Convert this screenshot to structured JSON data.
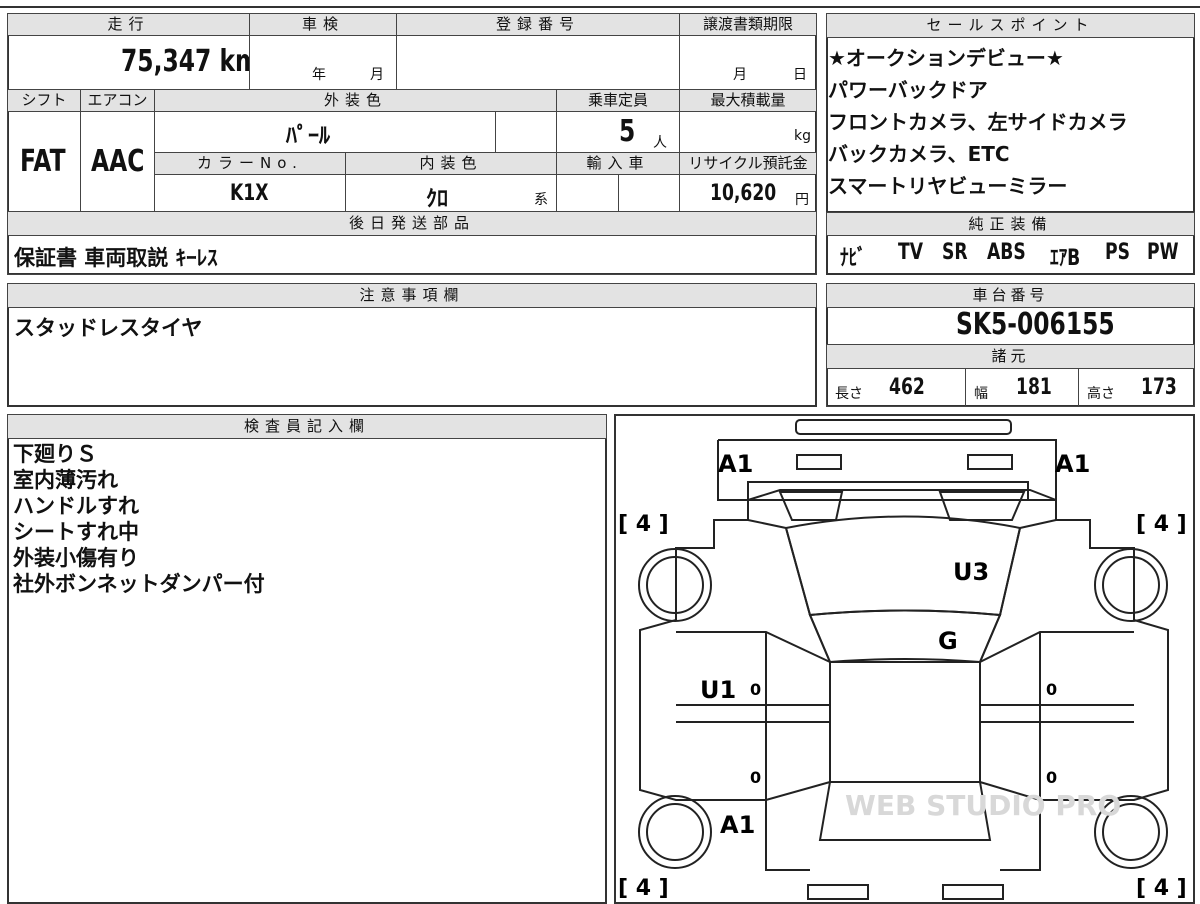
{
  "top_table": {
    "mileage_label": "走行",
    "mileage_value": "75,347 km",
    "inspection_label": "車検",
    "inspection_year": "年",
    "inspection_month": "月",
    "registration_label": "登録番号",
    "transfer_deadline_label": "譲渡書類期限",
    "transfer_month": "月",
    "transfer_day": "日",
    "shift_label": "シフト",
    "shift_value": "FAT",
    "aircon_label": "エアコン",
    "aircon_value": "AAC",
    "exterior_color_label": "外装色",
    "exterior_color_value": "ﾊﾟｰﾙ",
    "capacity_label": "乗車定員",
    "capacity_value": "5",
    "capacity_unit": "人",
    "max_load_label": "最大積載量",
    "max_load_unit": "kg",
    "color_no_label": "カラーNo.",
    "color_no_value": "K1X",
    "interior_color_label": "内装色",
    "interior_color_value": "ｸﾛ",
    "interior_color_suffix": "系",
    "import_label": "輸入車",
    "recycle_label": "リサイクル預託金",
    "recycle_value": "10,620",
    "recycle_unit": "円",
    "shipping_parts_label": "後日発送部品",
    "shipping_parts_value": "保証書 車両取説 ｷｰﾚｽ"
  },
  "sales_points": {
    "label": "セールスポイント",
    "lines": [
      "★オークションデビュー★",
      "パワーバックドア",
      "フロントカメラ、左サイドカメラ",
      "バックカメラ、ETC",
      "スマートリヤビューミラー"
    ]
  },
  "equipment": {
    "label": "純正装備",
    "items": [
      "ﾅﾋﾞ",
      "TV",
      "SR",
      "ABS",
      "ｴｱB",
      "PS",
      "PW"
    ]
  },
  "caution": {
    "label": "注意事項欄",
    "text": "スタッドレスタイヤ"
  },
  "chassis": {
    "label": "車台番号",
    "value": "SK5-006155",
    "spec_label": "諸元",
    "length_label": "長さ",
    "length_value": "462",
    "width_label": "幅",
    "width_value": "181",
    "height_label": "高さ",
    "height_value": "173"
  },
  "inspector": {
    "label": "検査員記入欄",
    "lines": [
      "下廻りＳ",
      "室内薄汚れ",
      "ハンドルすれ",
      "シートすれ中",
      "外装小傷有り",
      "社外ボンネットダンパー付"
    ]
  },
  "diagram": {
    "marks": {
      "front_left": "A1",
      "front_right": "A1",
      "hood": "U3",
      "windshield": "G",
      "left_front_door": "U1",
      "left_rear_quarter": "A1"
    },
    "tire_top_left": "[ 4 ]",
    "tire_top_right": "[ 4 ]",
    "tire_bottom_left": "[ 4 ]",
    "tire_bottom_right": "[ 4 ]",
    "zero": "0",
    "watermark": "WEB STUDIO PRO"
  }
}
